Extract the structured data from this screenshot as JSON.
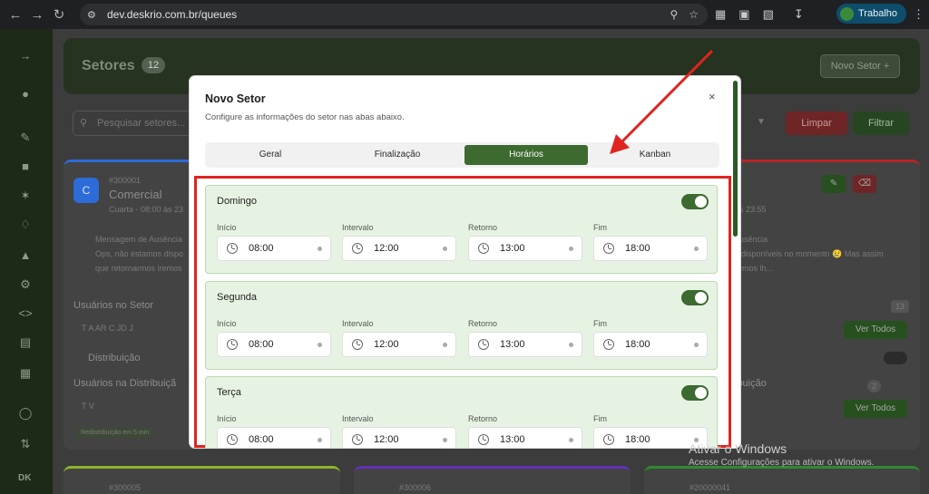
{
  "browser": {
    "url": "dev.deskrio.com.br/queues",
    "profile_label": "Trabalho"
  },
  "app": {
    "page_title": "Setores",
    "page_count": "12",
    "new_sector_label": "Novo Setor +",
    "search_placeholder": "Pesquisar setores...",
    "clear_label": "Limpar",
    "filter_label": "Filtrar",
    "sidebar_footer": "DK",
    "card1": {
      "avatar": "C",
      "id": "#300001",
      "name": "Comercial",
      "schedule": "Cuarta - 08:00 às 23",
      "absence_title": "Mensagem de Ausência",
      "absence_text1": "Ops, não estamos dispo",
      "absence_text2": "que retornarmos iremos",
      "users_title": "Usuários no Setor",
      "users_initials": "T A AR C JD J",
      "distribution_label": "Distribuição",
      "users_distribution": "Usuários na Distribuiçã",
      "dist_initials": "T V",
      "badge": "Redistribuição em 5 min"
    },
    "card2": {
      "schedule_end": "às 23:55",
      "absence_title": "ausência",
      "absence_text1": "s disponíveis no momento 😢 Mas assim",
      "absence_text2": "remos lh...",
      "count": "13",
      "view_all": "Ver Todos",
      "dist_label": "ibuição",
      "dist_count": "2",
      "view_all_2": "Ver Todos"
    },
    "bottom_ids": [
      "#300005",
      "#300006",
      "#20000041"
    ]
  },
  "modal": {
    "title": "Novo Setor",
    "subtitle": "Configure as informações do setor nas abas abaixo.",
    "close_glyph": "×",
    "tabs": [
      {
        "label": "Geral",
        "active": false
      },
      {
        "label": "Finalização",
        "active": false
      },
      {
        "label": "Horários",
        "active": true
      },
      {
        "label": "Kanban",
        "active": false
      }
    ],
    "field_labels": {
      "start": "Início",
      "break": "Intervalo",
      "return": "Retorno",
      "end": "Fim"
    },
    "days": [
      {
        "name": "Domingo",
        "enabled": true,
        "start": "08:00",
        "break": "12:00",
        "return": "13:00",
        "end": "18:00"
      },
      {
        "name": "Segunda",
        "enabled": true,
        "start": "08:00",
        "break": "12:00",
        "return": "13:00",
        "end": "18:00"
      },
      {
        "name": "Terça",
        "enabled": true,
        "start": "08:00",
        "break": "12:00",
        "return": "13:00",
        "end": "18:00"
      }
    ]
  },
  "windows_watermark": {
    "line1": "Ativar o Windows",
    "line2": "Acesse Configurações para ativar o Windows."
  },
  "colors": {
    "accent_green": "#3c6a2f",
    "highlight_red": "#e0241f",
    "day_bg": "#e7f3e2"
  }
}
